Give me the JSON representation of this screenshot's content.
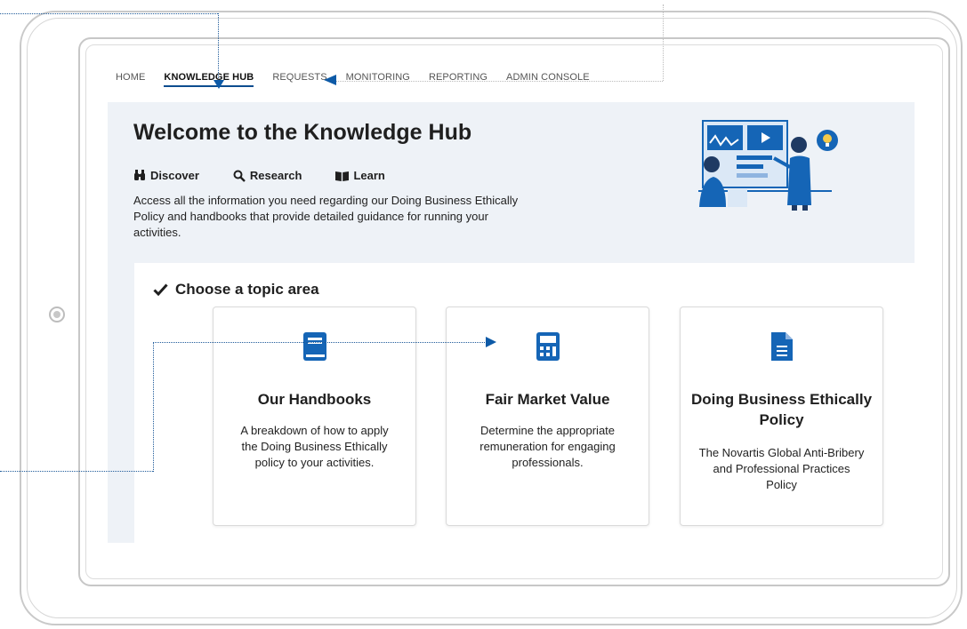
{
  "nav": {
    "items": [
      "HOME",
      "KNOWLEDGE HUB",
      "REQUESTS",
      "MONITORING",
      "REPORTING",
      "ADMIN CONSOLE"
    ],
    "active_index": 1
  },
  "hero": {
    "title": "Welcome to the Knowledge Hub",
    "features": [
      {
        "label": "Discover",
        "icon": "binoculars-icon"
      },
      {
        "label": "Research",
        "icon": "search-icon"
      },
      {
        "label": "Learn",
        "icon": "book-open-icon"
      }
    ],
    "description": "Access all the information you need regarding our Doing Business Ethically Policy and handbooks that provide detailed guidance for running your activities."
  },
  "topics": {
    "heading": "Choose a topic area",
    "cards": [
      {
        "title": "Our Handbooks",
        "description": "A breakdown of how to apply the Doing Business Ethically policy to your activities.",
        "icon": "book-icon"
      },
      {
        "title": "Fair Market Value",
        "description": "Determine the appropriate remuneration for engaging professionals.",
        "icon": "calculator-icon"
      },
      {
        "title": "Doing Business Ethically Policy",
        "description": "The Novartis Global Anti-Bribery and Professional Practices Policy",
        "icon": "document-icon"
      }
    ]
  },
  "colors": {
    "accent": "#0d5aa7",
    "hero_bg": "#eef2f7",
    "icon_blue": "#1565b6"
  }
}
